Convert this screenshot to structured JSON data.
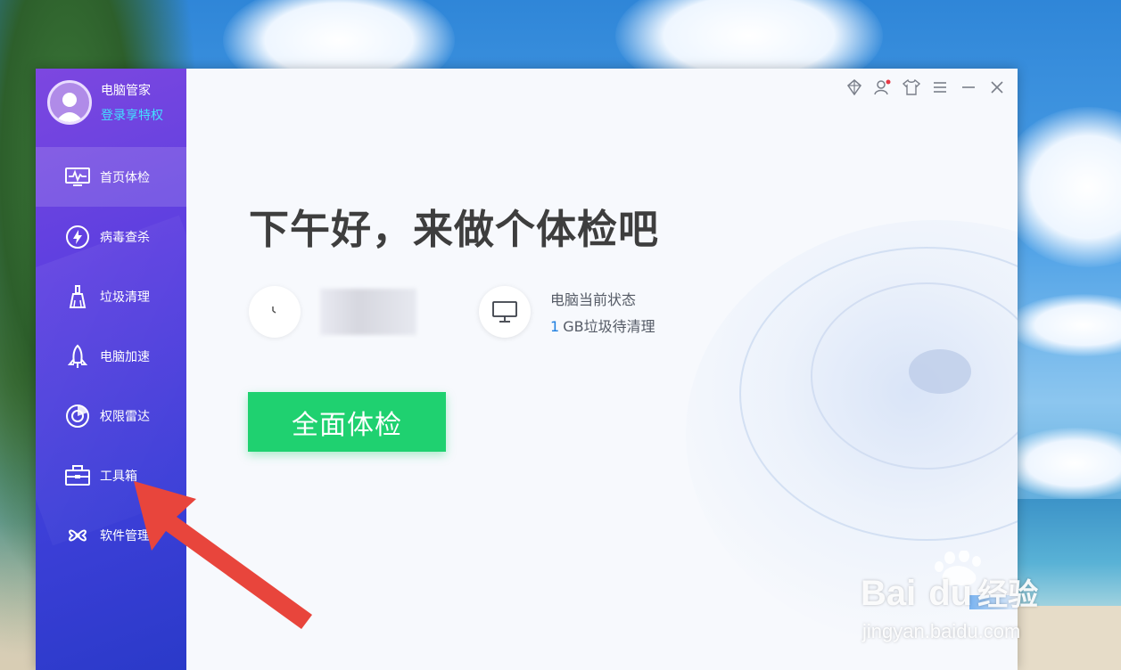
{
  "app": {
    "profile": {
      "name": "电脑管家",
      "login_link": "登录享特权"
    },
    "sidebar": {
      "items": [
        {
          "label": "首页体检",
          "icon": "monitor-pulse-icon",
          "active": true
        },
        {
          "label": "病毒查杀",
          "icon": "lightning-shield-icon",
          "active": false
        },
        {
          "label": "垃圾清理",
          "icon": "broom-icon",
          "active": false
        },
        {
          "label": "电脑加速",
          "icon": "rocket-icon",
          "active": false
        },
        {
          "label": "权限雷达",
          "icon": "radar-icon",
          "active": false
        },
        {
          "label": "工具箱",
          "icon": "toolbox-icon",
          "active": false
        },
        {
          "label": "软件管理",
          "icon": "software-clover-icon",
          "active": false
        }
      ]
    },
    "topbar": {
      "icons": [
        "gem-icon",
        "users-icon",
        "tshirt-icon",
        "menu-icon",
        "minimize-icon",
        "close-icon"
      ]
    },
    "main": {
      "greeting": "下午好，来做个体检吧",
      "status": {
        "title": "电脑当前状态",
        "amount": "1",
        "amount_suffix": "GB垃圾待清理"
      },
      "scan_button": "全面体检"
    },
    "colors": {
      "accent_green": "#1fd170",
      "accent_blue": "#1f7fe0",
      "sidebar_top": "#7d47e0",
      "sidebar_bottom": "#2a3ac9",
      "login_cyan": "#43e0ff"
    }
  },
  "watermark": {
    "brand_left": "Bai",
    "brand_right": "du",
    "brand_suffix": "经验",
    "url": "jingyan.baidu.com"
  }
}
